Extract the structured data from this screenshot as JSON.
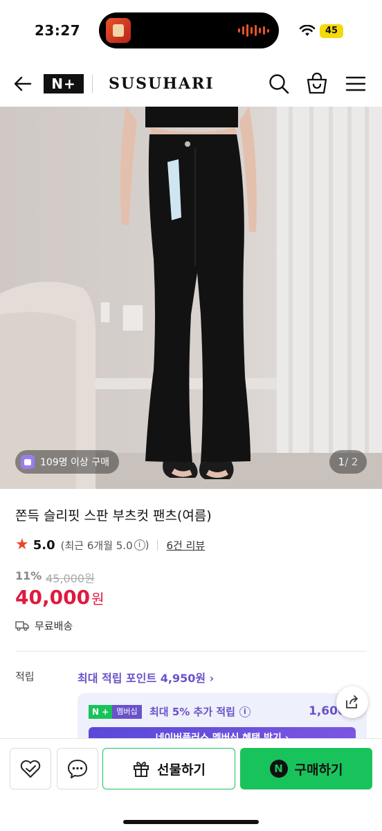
{
  "status_bar": {
    "time": "23:27",
    "battery": "45"
  },
  "header": {
    "naver_plus": "N+",
    "brand": "SUSUHARI"
  },
  "image": {
    "badge_text": "109명 이상 구매",
    "page_current": "1",
    "page_total": " / 2"
  },
  "product": {
    "title": "쫀득 슬리핏 스판 부츠컷 팬츠(여름)",
    "rating": "5.0",
    "rating_recent": "(최근 6개월 5.0",
    "info_icon": "i",
    "rating_recent_close": ")",
    "reviews": "6건 리뷰",
    "discount": "11%",
    "original_price": "45,000원",
    "price": "40,000",
    "price_unit": "원",
    "shipping": "무료배송"
  },
  "points": {
    "label": "적립",
    "max": "최대 적립 포인트 4,950원 ›",
    "member_tag_n": "N +",
    "member_tag": "멤버십",
    "member_text": "최대 5% 추가 적립",
    "member_amount": "1,600",
    "member_bar": "네이버플러스 멤버십 혜택 받기 ›"
  },
  "bottom": {
    "gift": "선물하기",
    "buy": "구매하기",
    "n_logo": "N"
  },
  "colors": {
    "naver_green": "#19c35b",
    "price_red": "#e0193f",
    "member_purple": "#6b52c9"
  }
}
